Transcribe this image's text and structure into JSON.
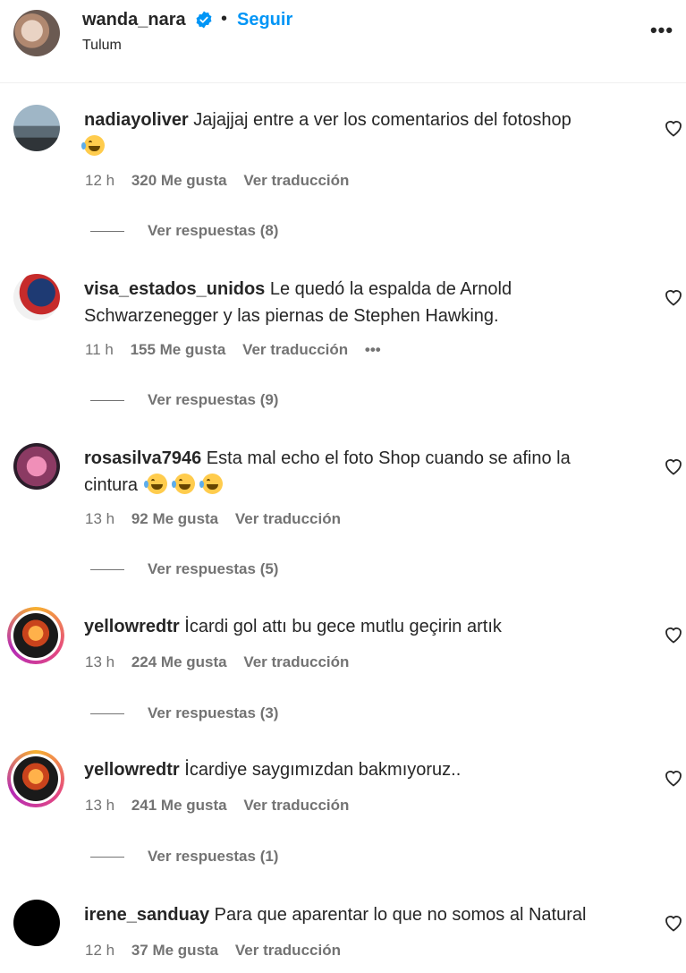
{
  "header": {
    "username": "wanda_nara",
    "separator": "•",
    "follow_label": "Seguir",
    "location": "Tulum",
    "more_label": "•••"
  },
  "comments": [
    {
      "username": "nadiayoliver",
      "text": "Jajajjaj entre a ver los comentarios del fotoshop",
      "emoji_count": 1,
      "time": "12 h",
      "likes": "320 Me gusta",
      "translate": "Ver traducción",
      "replies": "Ver respuestas (8)"
    },
    {
      "username": "visa_estados_unidos",
      "text": "Le quedó la espalda de Arnold Schwarzenegger y las piernas de Stephen Hawking.",
      "emoji_count": 0,
      "time": "11 h",
      "likes": "155 Me gusta",
      "translate": "Ver traducción",
      "options": "•••",
      "replies": "Ver respuestas (9)"
    },
    {
      "username": "rosasilva7946",
      "text": "Esta mal echo el foto Shop cuando se afino la cintura",
      "emoji_count": 3,
      "time": "13 h",
      "likes": "92 Me gusta",
      "translate": "Ver traducción",
      "replies": "Ver respuestas (5)"
    },
    {
      "username": "yellowredtr",
      "text": "İcardi gol attı bu gece mutlu geçirin artık",
      "emoji_count": 0,
      "time": "13 h",
      "likes": "224 Me gusta",
      "translate": "Ver traducción",
      "replies": "Ver respuestas (3)"
    },
    {
      "username": "yellowredtr",
      "text": "İcardiye saygımızdan bakmıyoruz..",
      "emoji_count": 0,
      "time": "13 h",
      "likes": "241 Me gusta",
      "translate": "Ver traducción",
      "replies": "Ver respuestas (1)"
    },
    {
      "username": "irene_sanduay",
      "text": "Para que aparentar lo que no somos al Natural",
      "emoji_count": 0,
      "time": "12 h",
      "likes": "37 Me gusta",
      "translate": "Ver traducción"
    }
  ],
  "colors": {
    "link_blue": "#0095f6",
    "secondary_text": "#737373",
    "primary_text": "#262626"
  }
}
